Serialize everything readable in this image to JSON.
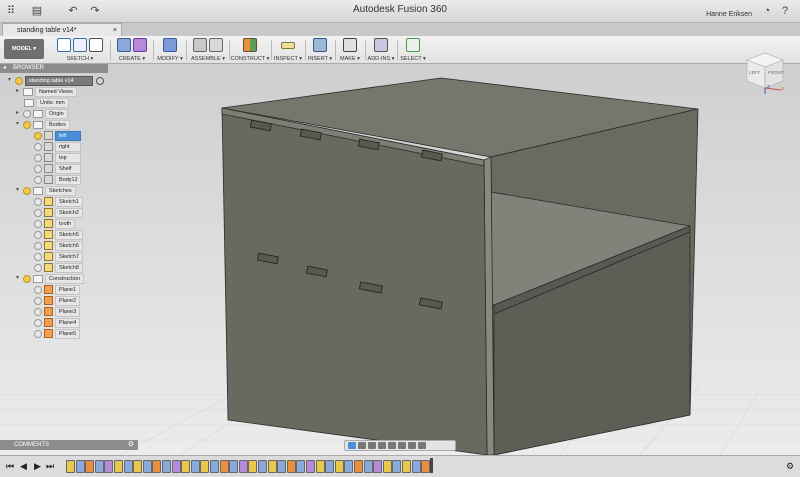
{
  "app": {
    "title": "Autodesk Fusion 360",
    "user": "Hanne Eriksen"
  },
  "tab": {
    "title": "standing table v14*"
  },
  "workspace": {
    "label": "MODEL ▾"
  },
  "ribbon": {
    "groups": [
      "SKETCH ▾",
      "CREATE ▾",
      "MODIFY ▾",
      "ASSEMBLE ▾",
      "CONSTRUCT ▾",
      "INSPECT ▾",
      "INSERT ▾",
      "MAKE ▾",
      "ADD-INS ▾",
      "SELECT ▾"
    ]
  },
  "browser": {
    "header": "BROWSER",
    "root": "standing table v14",
    "named_views": "Named Views",
    "units": "Units: mm",
    "origin": "Origin",
    "bodies": {
      "label": "Bodies",
      "items": [
        "left",
        "right",
        "top",
        "Shelf",
        "Body12"
      ],
      "selected": "left"
    },
    "sketches": {
      "label": "Sketches",
      "items": [
        "Sketch1",
        "Sketch2",
        "tooth",
        "Sketch5",
        "Sketch6",
        "Sketch7",
        "Sketch8"
      ]
    },
    "construction": {
      "label": "Construction",
      "items": [
        "Plane1",
        "Plane2",
        "Plane3",
        "Plane4",
        "Plane5"
      ]
    }
  },
  "comments": {
    "label": "COMMENTS"
  },
  "viewcube": {
    "left": "LEFT",
    "front": "FRONT",
    "axes": [
      "Z",
      "X"
    ]
  },
  "colors": {
    "selection_blue": "#4a90d9",
    "ribbon_bg": "#ececec",
    "panel_gray": "#8c8c8c",
    "body_dark": "#6a6960"
  }
}
